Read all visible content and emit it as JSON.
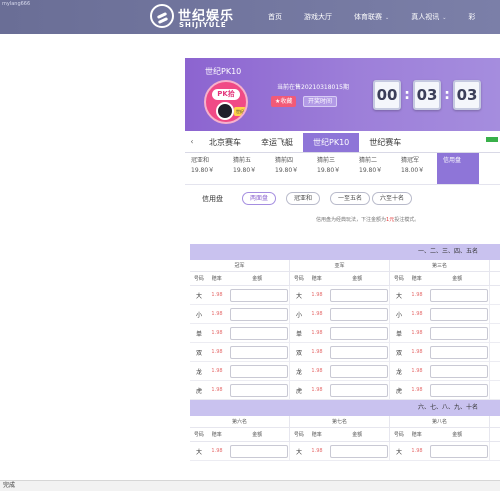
{
  "site_url": "mylang666",
  "logo": {
    "cn": "世纪娱乐",
    "en": "SHIJIYULE"
  },
  "nav": [
    {
      "label": "首页",
      "dropdown": false
    },
    {
      "label": "游戏大厅",
      "dropdown": false
    },
    {
      "label": "体育联赛",
      "dropdown": true
    },
    {
      "label": "真人视讯",
      "dropdown": true
    },
    {
      "label": "彩",
      "dropdown": false
    }
  ],
  "banner": {
    "game_name": "世纪PK10",
    "logo_text": "PK拾",
    "logo_tag": "世纪",
    "period": "当前在售20210318015期",
    "fav_label": "★收藏",
    "time_label": "开奖时间",
    "timer": [
      "00",
      "03",
      "03"
    ]
  },
  "tabs": [
    "北京赛车",
    "幸运飞艇",
    "世纪PK10",
    "世纪赛车"
  ],
  "active_tab": 2,
  "subtabs": [
    {
      "label": "冠亚和",
      "odds": "19.80￥"
    },
    {
      "label": "猜前五",
      "odds": "19.80￥"
    },
    {
      "label": "猜前四",
      "odds": "19.80￥"
    },
    {
      "label": "猜前三",
      "odds": "19.80￥"
    },
    {
      "label": "猜前二",
      "odds": "19.80￥"
    },
    {
      "label": "猜冠军",
      "odds": "18.00￥"
    },
    {
      "label": "信用盘",
      "odds": ""
    }
  ],
  "mode": {
    "label": "信用盘",
    "pills": [
      "两面盘",
      "冠亚和",
      "一至五名",
      "六至十名"
    ],
    "active_pill": 0,
    "note_prefix": "信用盘为经典玩法，下注金额为",
    "note_highlight": "1元",
    "note_suffix": "投注模式。"
  },
  "sections": [
    {
      "title": "一、二、三、四、五名",
      "columns": [
        "冠军",
        "亚军",
        "第三名"
      ],
      "subheads": [
        "号码",
        "赔率",
        "金额"
      ],
      "rows": [
        {
          "name": "大",
          "odds": "1.98"
        },
        {
          "name": "小",
          "odds": "1.98"
        },
        {
          "name": "单",
          "odds": "1.98"
        },
        {
          "name": "双",
          "odds": "1.98"
        },
        {
          "name": "龙",
          "odds": "1.98"
        },
        {
          "name": "虎",
          "odds": "1.98"
        }
      ]
    },
    {
      "title": "六、七、八、九、十名",
      "columns": [
        "第六名",
        "第七名",
        "第八名"
      ],
      "subheads": [
        "号码",
        "赔率",
        "金额"
      ],
      "rows": [
        {
          "name": "大",
          "odds": "1.98"
        }
      ]
    }
  ],
  "status_text": "完成"
}
